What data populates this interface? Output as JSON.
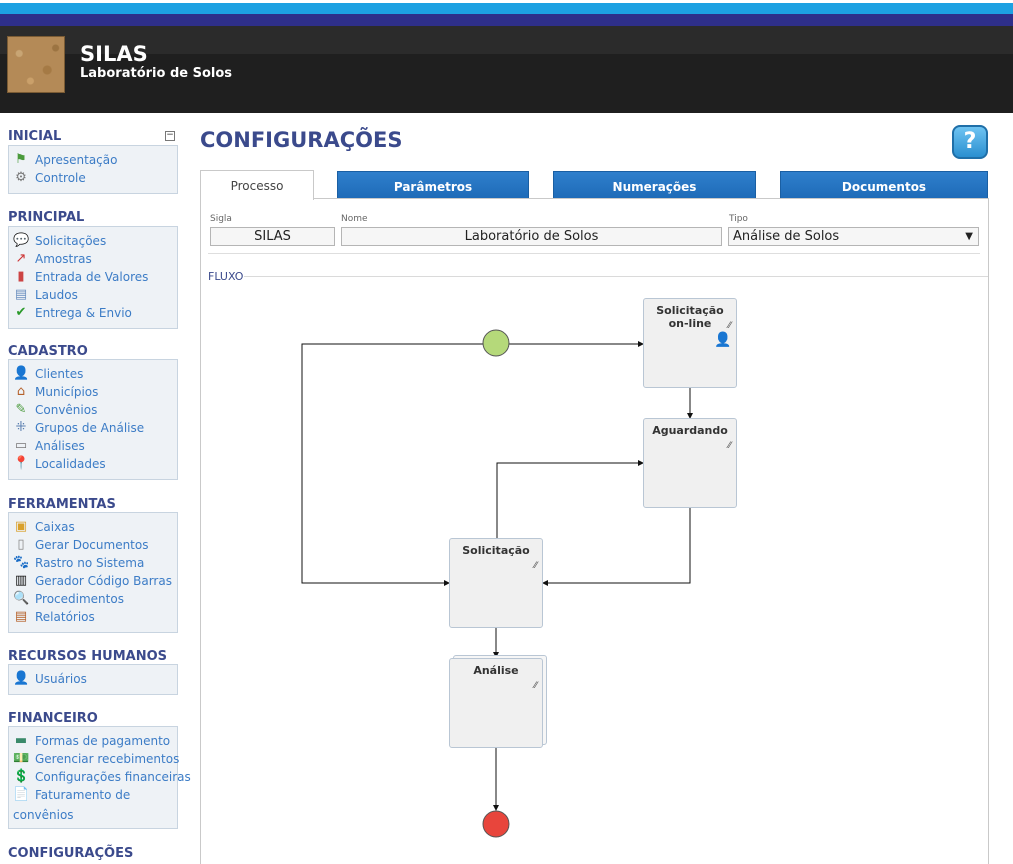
{
  "header": {
    "title": "SILAS",
    "subtitle": "Laboratório de Solos"
  },
  "sidebar": {
    "inicial": {
      "title": "INICIAL",
      "items": [
        "Apresentação",
        "Controle"
      ]
    },
    "principal": {
      "title": "PRINCIPAL",
      "items": [
        "Solicitações",
        "Amostras",
        "Entrada de Valores",
        "Laudos",
        "Entrega & Envio"
      ]
    },
    "cadastro": {
      "title": "CADASTRO",
      "items": [
        "Clientes",
        "Municípios",
        "Convênios",
        "Grupos de Análise",
        "Análises",
        "Localidades"
      ]
    },
    "ferramentas": {
      "title": "FERRAMENTAS",
      "items": [
        "Caixas",
        "Gerar Documentos",
        "Rastro no Sistema",
        "Gerador Código Barras",
        "Procedimentos",
        "Relatórios"
      ]
    },
    "rh": {
      "title": "RECURSOS HUMANOS",
      "items": [
        "Usuários"
      ]
    },
    "financeiro": {
      "title": "FINANCEIRO",
      "items": [
        "Formas de pagamento",
        "Gerenciar recebimentos",
        "Configurações financeiras"
      ],
      "item_multiline_1": "Faturamento de",
      "item_multiline_2": "convênios"
    },
    "configuracoes": {
      "title": "CONFIGURAÇÕES"
    }
  },
  "main": {
    "title": "CONFIGURAÇÕES",
    "help_icon": "?",
    "tabs": [
      "Processo",
      "Parâmetros",
      "Numerações",
      "Documentos"
    ],
    "form": {
      "sigla_label": "Sigla",
      "sigla_value": "SILAS",
      "nome_label": "Nome",
      "nome_value": "Laboratório de Solos",
      "tipo_label": "Tipo",
      "tipo_value": "Análise de Solos"
    },
    "fluxo_label": "FLUXO",
    "flow_nodes": {
      "n1": "Solicitação on-line",
      "n2": "Aguardando",
      "n3": "Solicitação",
      "n4": "Análise"
    }
  },
  "colors": {
    "accent": "#3b4a8c",
    "link": "#3c7cc6",
    "start": "#b5d97a",
    "end": "#e8453c",
    "tab_blue": "#2f7fcc"
  }
}
